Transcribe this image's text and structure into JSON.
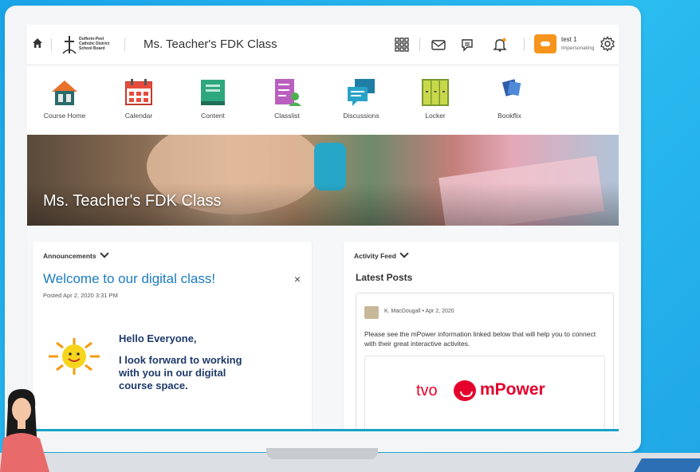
{
  "topbar": {
    "course_title": "Ms. Teacher's FDK Class",
    "logo_text": "Dufferin-Peel Catholic District School Board",
    "user_name": "test 1",
    "user_role": "Impersonating"
  },
  "nav": {
    "items": [
      {
        "label": "Course Home",
        "icon": "house-icon"
      },
      {
        "label": "Calendar",
        "icon": "calendar-icon"
      },
      {
        "label": "Content",
        "icon": "book-icon"
      },
      {
        "label": "Classlist",
        "icon": "classlist-icon"
      },
      {
        "label": "Discussions",
        "icon": "discussions-icon"
      },
      {
        "label": "Locker",
        "icon": "locker-icon"
      },
      {
        "label": "Bookflix",
        "icon": "bookflix-icon"
      }
    ]
  },
  "banner": {
    "title": "Ms. Teacher's FDK Class"
  },
  "announcements": {
    "header": "Announcements",
    "title": "Welcome to our digital class!",
    "posted": "Posted Apr 2, 2020 3:31 PM",
    "line1": "Hello Everyone,",
    "line2": "I look forward to working",
    "line3": "with you in our digital",
    "line4": "course space."
  },
  "activity": {
    "header": "Activity Feed",
    "latest": "Latest Posts",
    "author": "K. MacDougall",
    "date": "Apr 2, 2020",
    "body": "Please see the mPower information linked below that will help you to connect with their great interactive activites.",
    "brand_left": "tvo",
    "brand_right": "mPower"
  },
  "colors": {
    "accent": "#1b7bc2",
    "brand_orange": "#f7941d",
    "mpower_red": "#e4002b",
    "background": "#1aa3e8"
  }
}
